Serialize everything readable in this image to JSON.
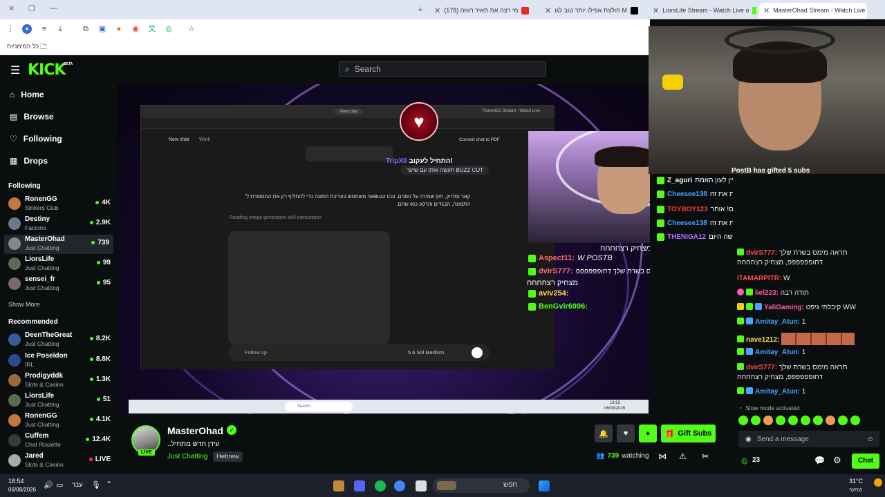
{
  "browser": {
    "tabs": [
      {
        "title": "MasterOhad Stream - Watch Live o",
        "active": true
      },
      {
        "title": "LiorsLife Stream - Watch Live o"
      },
      {
        "title": "חולצת אפילו יותר טוב לגו M"
      },
      {
        "title": "(178) מי רצה את תאיר ראזה"
      }
    ],
    "bookmarks_label": "כל הסימניות"
  },
  "kick": {
    "logo": "KICK",
    "logo_tag": "BETA",
    "search_placeholder": "Search",
    "nav": [
      {
        "label": "Home",
        "icon": "home-icon"
      },
      {
        "label": "Browse",
        "icon": "browse-icon"
      },
      {
        "label": "Following",
        "icon": "heart-icon"
      },
      {
        "label": "Drops",
        "icon": "drops-icon"
      }
    ],
    "following_title": "Following",
    "following": [
      {
        "name": "RonenGG",
        "category": "Strikers Club",
        "viewers": "4K",
        "color": "#c2793a"
      },
      {
        "name": "Destiny",
        "category": "Factorio",
        "viewers": "2.9K",
        "color": "#6a7a8a"
      },
      {
        "name": "MasterOhad",
        "category": "Just Chatting",
        "viewers": "739",
        "color": "#888888"
      },
      {
        "name": "LiorsLife",
        "category": "Just Chatting",
        "viewers": "99",
        "color": "#5a6a55"
      },
      {
        "name": "sensei_fr",
        "category": "Just Chatting",
        "viewers": "95",
        "color": "#7a6a6a"
      }
    ],
    "show_more": "Show More",
    "recommended_title": "Recommended",
    "recommended": [
      {
        "name": "DeenTheGreat",
        "category": "Just Chatting",
        "viewers": "8.2K",
        "color": "#3a5a9a"
      },
      {
        "name": "Ice Poseidon",
        "category": "IRL",
        "viewers": "8.8K",
        "color": "#2a4a8a"
      },
      {
        "name": "Prodigyddk",
        "category": "Slots & Casino",
        "viewers": "1.3K",
        "color": "#9a6a3a"
      },
      {
        "name": "LiorsLife",
        "category": "Just Chatting",
        "viewers": "51",
        "color": "#5a6a55"
      },
      {
        "name": "RonenGG",
        "category": "Just Chatting",
        "viewers": "4.1K",
        "color": "#c2793a"
      },
      {
        "name": "Cuffem",
        "category": "Chat Roulette",
        "viewers": "12.4K",
        "color": "#3a3a3a"
      },
      {
        "name": "Jared",
        "category": "Slots & Casino",
        "viewers": "LIVE",
        "color": "#aaaaaa"
      }
    ]
  },
  "video": {
    "inner_tab1": "New chat",
    "inner_tab2": "RonenGG Stream - Watch Live",
    "inner_chat_title": "New chat",
    "inner_chat_ws": "Work",
    "export_pdf": "Convert chat to PDF",
    "inner_text_1": "קאר ומדויק, חוץ שמירה על הפנים, Buzz Cutאני משתמש בעריכת תמונה כדי להחליף רק את התספורת ל'",
    "inner_text_2": "התמונה, הבגדים והרקע כמו שהם.",
    "inner_skill": "Reading image generation skill instructions",
    "inner_followup": "Follow up",
    "inner_model": "5.6 Sol Medium",
    "overlay_user": "TripX0",
    "overlay_msg": "התחיל לעקוב!",
    "overlay_sub": "תעשה אותו עם שיער BUZZ CUT",
    "overlay_chat": [
      {
        "user": "",
        "text": "מצחיק רצחחחח",
        "color": "#ffffff"
      },
      {
        "user": "Aspect11:",
        "text": "W POSTB",
        "color": "#ff6b6b"
      },
      {
        "user": "dvirS777:",
        "text": "תראה מימס בשרת שלך דחופפפפפפ",
        "color": "#ff6b6b"
      },
      {
        "user": "",
        "text": "מצחיק רצחחחח",
        "color": "#ffffff"
      },
      {
        "user": "aviv254:",
        "text": "",
        "color": "#ffd84a"
      },
      {
        "user": "BenGvir6996:",
        "text": "",
        "color": "#53fc18"
      }
    ],
    "taskbar_search": "Search",
    "taskbar_time": "18:53",
    "taskbar_date": "06/08/2026"
  },
  "webcam_overlay": {
    "lines": [
      {
        "user": "Z_aguri",
        "text": "עדיין לא מצחיק את זה עדיין לעון האמת"
      },
      {
        "user": "Cheesee138",
        "text": "סמיילרגת גם לי יזין הכוכבות לראות את זה"
      },
      {
        "user": "TOYBOY123",
        "text": "צאט יקר שלחו בדיסקורד תספורות שלכם! אוחר"
      },
      {
        "user": "Cheesee138",
        "text": "סמיילרגת גם לי יזין הכוכבות לראות את זה"
      },
      {
        "user": "THENIGA12",
        "text": "אחרי תעשה היום WATERPARK"
      }
    ],
    "gift_banner": "PostB has gifted 5 subs"
  },
  "chat": {
    "messages": [
      {
        "user": "dvirS777:",
        "color": "#ff4d4d",
        "text": "תראה מימס בשרת שלך דחופפפפפפ, מצחיק רצחחחח"
      },
      {
        "user": "ITAMARPITR:",
        "color": "#ff4d4d",
        "text": "W"
      },
      {
        "user": "liel223:",
        "color": "#ff5fa2",
        "text": "תודה רבה"
      },
      {
        "user": "YaliGaming:",
        "color": "#ff5fa2",
        "text": "קיבלתי גיפט WW"
      },
      {
        "user": "Amitay_Atun:",
        "color": "#4aa3ff",
        "text": "1"
      },
      {
        "user": "nave1212:",
        "color": "#ffd84a",
        "text": ""
      },
      {
        "user": "Amitay_Atun:",
        "color": "#4aa3ff",
        "text": "1"
      },
      {
        "user": "dvirS777:",
        "color": "#ff4d4d",
        "text": "תראה מימס בשרת שלך דחופפפפפפ, מצחיק רצחחחח"
      },
      {
        "user": "Amitay_Atun:",
        "color": "#4aa3ff",
        "text": "1"
      }
    ],
    "slow_mode": "Slow mode activated",
    "input_placeholder": "Send a message",
    "points": "23",
    "chat_button": "Chat"
  },
  "stream": {
    "name": "MasterOhad",
    "title": "..עידן חדש מתחיל",
    "category": "Just Chatting",
    "tag": "Hebrew",
    "live_label": "LIVE",
    "viewers": "739",
    "viewers_label": "watching",
    "gift_subs": "Gift Subs"
  },
  "os": {
    "time": "18:54",
    "date": "06/08/2026",
    "lang": "עבר",
    "search_label": "חפש",
    "weather_temp": "31°C",
    "weather_desc": "שמשי"
  },
  "colors": {
    "accent": "#53fc18",
    "bg": "#0b0e0f"
  }
}
